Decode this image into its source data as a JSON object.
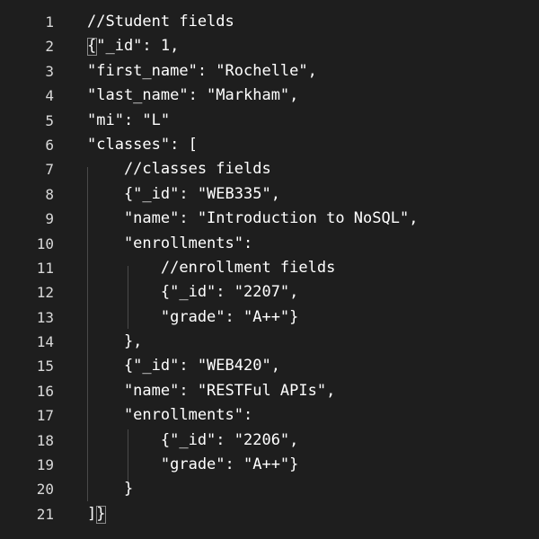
{
  "editor": {
    "lines": [
      {
        "number": "1",
        "text": "//Student fields"
      },
      {
        "number": "2",
        "text": "{\"_id\": 1,"
      },
      {
        "number": "3",
        "text": "\"first_name\": \"Rochelle\","
      },
      {
        "number": "4",
        "text": "\"last_name\": \"Markham\","
      },
      {
        "number": "5",
        "text": "\"mi\": \"L\""
      },
      {
        "number": "6",
        "text": "\"classes\": ["
      },
      {
        "number": "7",
        "text": "    //classes fields"
      },
      {
        "number": "8",
        "text": "    {\"_id\": \"WEB335\","
      },
      {
        "number": "9",
        "text": "    \"name\": \"Introduction to NoSQL\","
      },
      {
        "number": "10",
        "text": "    \"enrollments\":"
      },
      {
        "number": "11",
        "text": "        //enrollment fields"
      },
      {
        "number": "12",
        "text": "        {\"_id\": \"2207\","
      },
      {
        "number": "13",
        "text": "        \"grade\": \"A++\"}"
      },
      {
        "number": "14",
        "text": "    },"
      },
      {
        "number": "15",
        "text": "    {\"_id\": \"WEB420\","
      },
      {
        "number": "16",
        "text": "    \"name\": \"RESTFul APIs\","
      },
      {
        "number": "17",
        "text": "    \"enrollments\":"
      },
      {
        "number": "18",
        "text": "        {\"_id\": \"2206\","
      },
      {
        "number": "19",
        "text": "        \"grade\": \"A++\"}"
      },
      {
        "number": "20",
        "text": "    }"
      },
      {
        "number": "21",
        "text": "]}"
      }
    ]
  }
}
